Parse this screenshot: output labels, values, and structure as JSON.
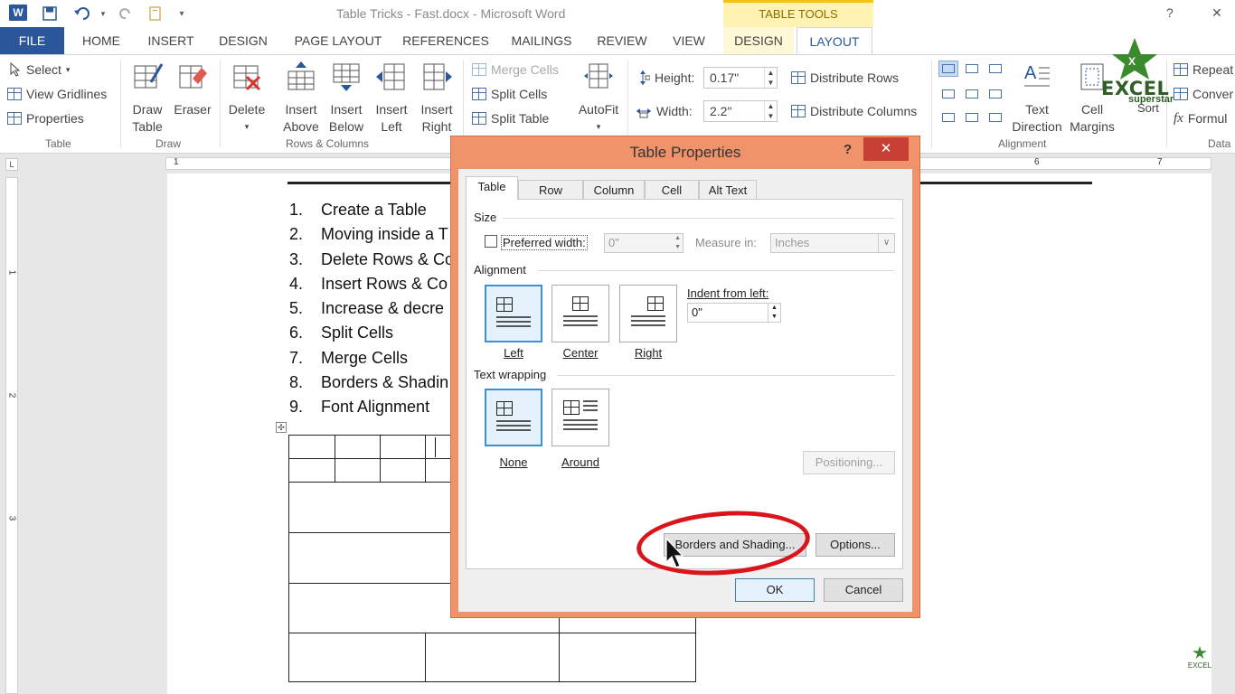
{
  "window": {
    "title": "Table Tricks - Fast.docx - Microsoft Word",
    "context_band": "TABLE TOOLS",
    "help": "?",
    "close": "✕"
  },
  "ribbon_tabs": [
    "FILE",
    "HOME",
    "INSERT",
    "DESIGN",
    "PAGE LAYOUT",
    "REFERENCES",
    "MAILINGS",
    "REVIEW",
    "VIEW",
    "DESIGN",
    "LAYOUT"
  ],
  "ribbon": {
    "table_group": {
      "select": "Select",
      "view_gridlines": "View Gridlines",
      "properties": "Properties",
      "label": "Table"
    },
    "draw_group": {
      "draw_table": [
        "Draw",
        "Table"
      ],
      "eraser": "Eraser",
      "label": "Draw"
    },
    "rows_cols_group": {
      "delete": "Delete",
      "insert_above": [
        "Insert",
        "Above"
      ],
      "insert_below": [
        "Insert",
        "Below"
      ],
      "insert_left": [
        "Insert",
        "Left"
      ],
      "insert_right": [
        "Insert",
        "Right"
      ],
      "label": "Rows & Columns"
    },
    "merge_group": {
      "merge_cells": "Merge Cells",
      "split_cells": "Split Cells",
      "split_table": "Split Table",
      "autofit": "AutoFit"
    },
    "cell_size_group": {
      "height_label": "Height:",
      "height_value": "0.17\"",
      "width_label": "Width:",
      "width_value": "2.2\"",
      "distribute_rows": "Distribute Rows",
      "distribute_columns": "Distribute Columns"
    },
    "alignment_group": {
      "text_direction": [
        "Text",
        "Direction"
      ],
      "cell_margins": [
        "Cell",
        "Margins"
      ],
      "sort": "Sort",
      "label": "Alignment"
    },
    "data_group": {
      "repeat": "Repeat",
      "convert": "Conver",
      "formula": "Formul",
      "label": "Data"
    }
  },
  "ruler": {
    "marks": [
      "1",
      "6",
      "7"
    ],
    "corner": "L",
    "vertical_marks": [
      "1",
      "2",
      "3"
    ]
  },
  "document": {
    "list": [
      {
        "num": "1.",
        "text": "Create a Table"
      },
      {
        "num": "2.",
        "text": "Moving inside a T"
      },
      {
        "num": "3.",
        "text": "Delete Rows & Co"
      },
      {
        "num": "4.",
        "text": "Insert Rows & Co"
      },
      {
        "num": "5.",
        "text": "Increase & decre"
      },
      {
        "num": "6.",
        "text": "Split Cells"
      },
      {
        "num": "7.",
        "text": "Merge Cells"
      },
      {
        "num": "8.",
        "text": "Borders & Shadin"
      },
      {
        "num": "9.",
        "text": "Font Alignment"
      }
    ],
    "table_handle": "✣"
  },
  "dialog": {
    "title": "Table Properties",
    "help": "?",
    "close": "✕",
    "tabs": [
      "Table",
      "Row",
      "Column",
      "Cell",
      "Alt Text"
    ],
    "size_section": "Size",
    "preferred_width_label": "Preferred width:",
    "preferred_width_value": "0\"",
    "measure_in_label": "Measure in:",
    "measure_in_value": "Inches",
    "alignment_section": "Alignment",
    "align_options": [
      "Left",
      "Center",
      "Right"
    ],
    "indent_label": "Indent from left:",
    "indent_value": "0\"",
    "wrapping_section": "Text wrapping",
    "wrap_options": [
      "None",
      "Around"
    ],
    "positioning": "Positioning...",
    "borders_shading": "Borders and Shading...",
    "options": "Options...",
    "ok": "OK",
    "cancel": "Cancel"
  },
  "logo": {
    "word": "EXCEL",
    "sub": "superstar",
    "mini": "EXCEL"
  },
  "colors": {
    "file_tab": "#2b579a",
    "dialog_frame": "#f0936a",
    "close_button": "#c83f33",
    "highlight": "#d9141a",
    "context_band": "#fff2b3"
  }
}
